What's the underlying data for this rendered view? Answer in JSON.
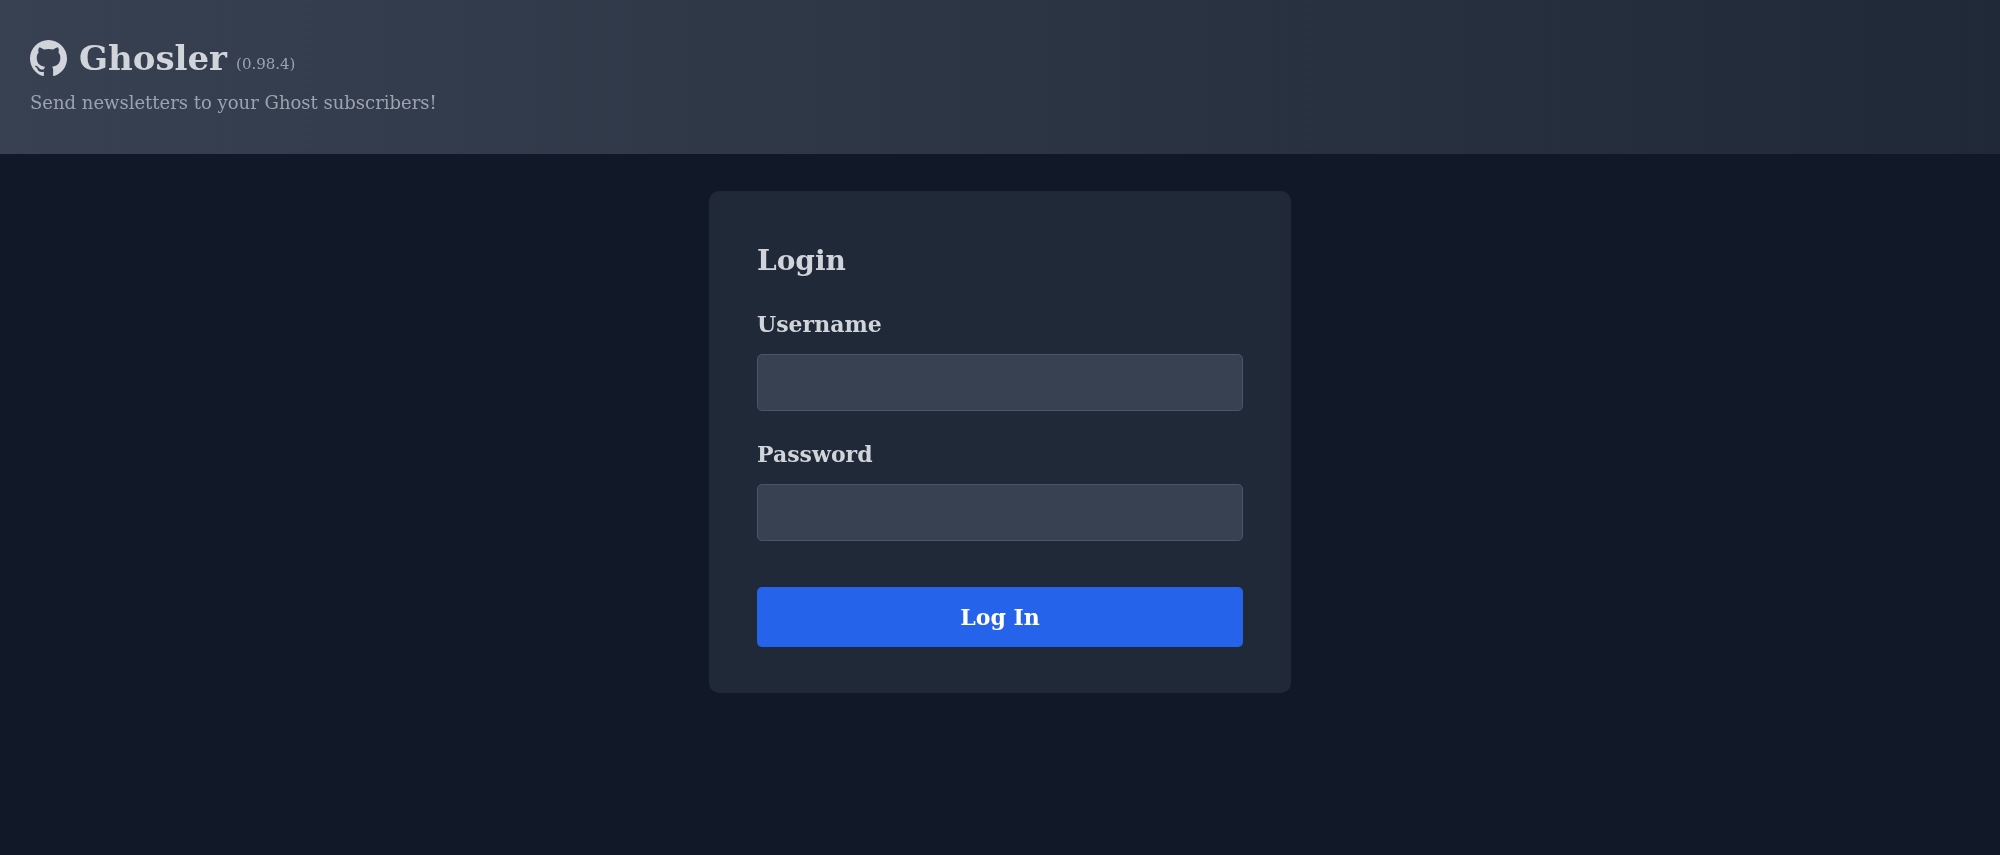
{
  "header": {
    "app_name": "Ghosler",
    "version": "(0.98.4)",
    "tagline": "Send newsletters to your Ghost subscribers!"
  },
  "login_form": {
    "title": "Login",
    "fields": [
      {
        "label": "Username"
      },
      {
        "label": "Password"
      }
    ],
    "submit_button": "Log In"
  }
}
